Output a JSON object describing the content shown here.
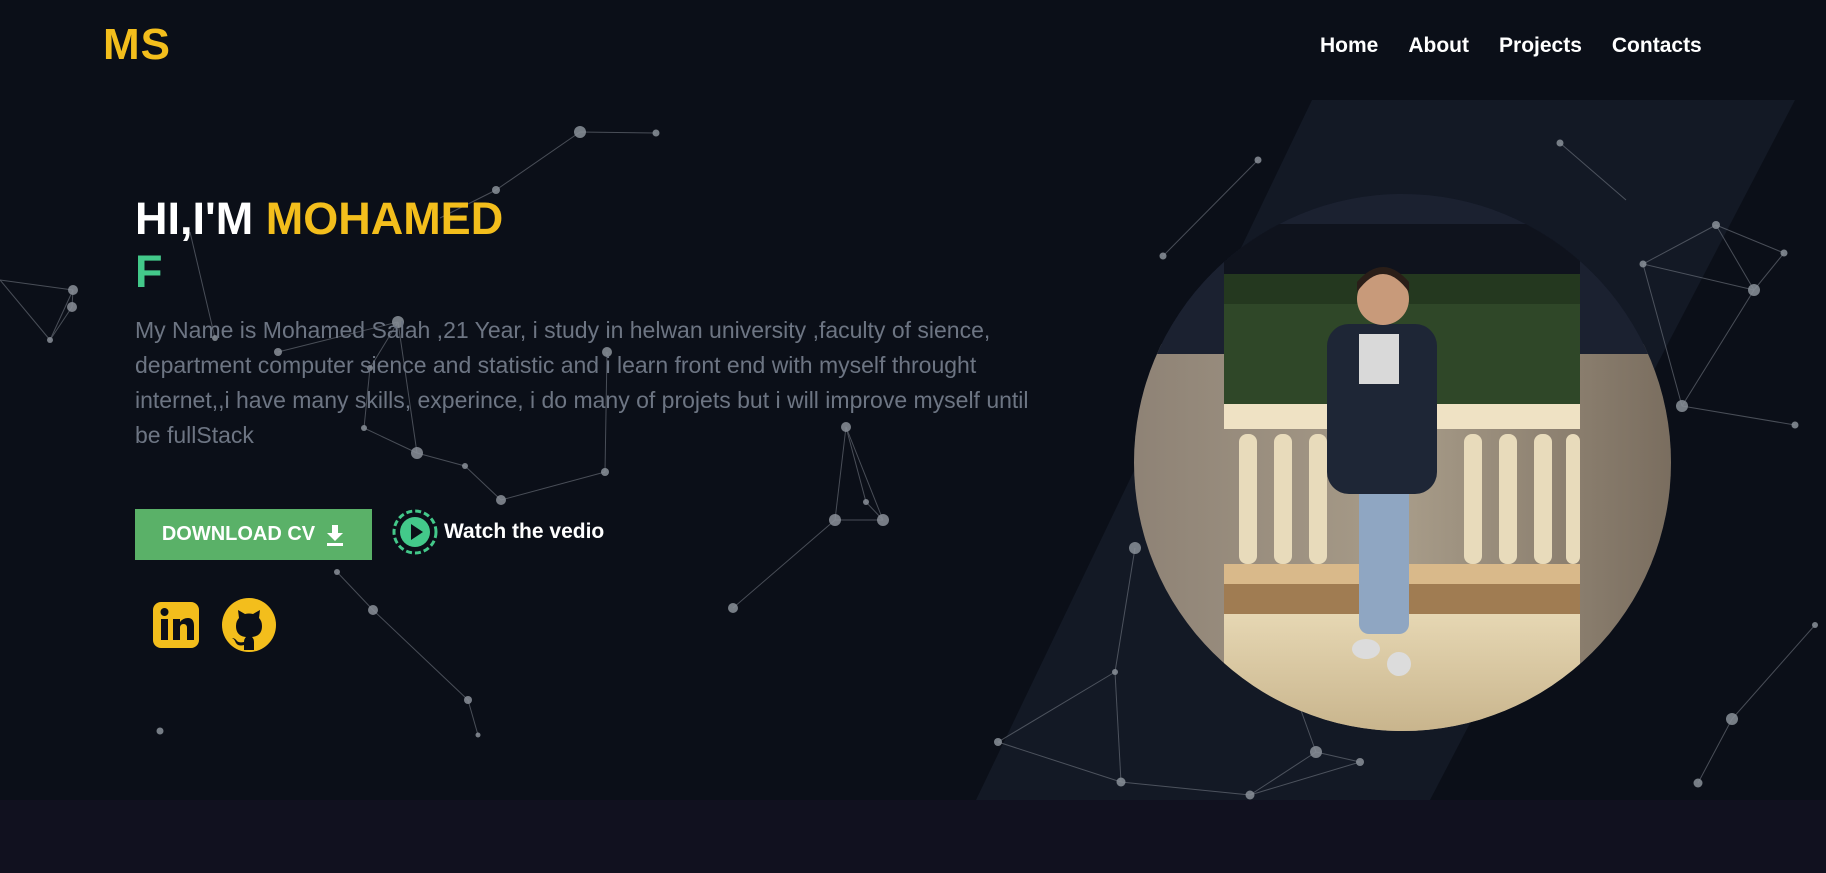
{
  "header": {
    "logo": "MS",
    "nav": [
      "Home",
      "About",
      "Projects",
      "Contacts"
    ]
  },
  "hero": {
    "greeting": "HI,I'M",
    "name": "MOHAMED",
    "typed_text": "F",
    "bio": "My Name is Mohamed Salah ,21 Year, i study in helwan university ,faculty of sience, department computer sience and statistic and i learn front end with myself throught internet,,i have many skills, experince, i do many of projets but i will improve myself until be fullStack",
    "download_label": "DOWNLOAD CV",
    "watch_label": "Watch the vedio"
  },
  "social": [
    "linkedin-icon",
    "github-icon"
  ],
  "colors": {
    "accent_yellow": "#f3be1c",
    "accent_green": "#43c98a",
    "button_green": "#5ab168",
    "background": "#0b0f18"
  }
}
